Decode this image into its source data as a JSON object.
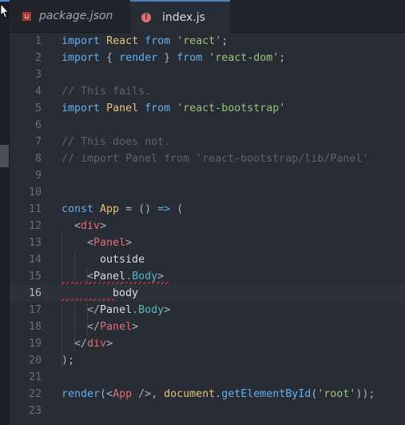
{
  "tabs": [
    {
      "label": "package.json",
      "icon": "npm-package-icon",
      "active": false
    },
    {
      "label": "index.js",
      "icon": "error-icon",
      "active": true
    }
  ],
  "editor": {
    "current_line": 16,
    "lines": [
      {
        "n": "1",
        "tokens": [
          [
            "kw",
            "import"
          ],
          [
            "op",
            " "
          ],
          [
            "cls",
            "React"
          ],
          [
            "op",
            " "
          ],
          [
            "kw",
            "from"
          ],
          [
            "op",
            " "
          ],
          [
            "str",
            "'react'"
          ],
          [
            "op",
            ";"
          ]
        ]
      },
      {
        "n": "2",
        "tokens": [
          [
            "kw",
            "import"
          ],
          [
            "op",
            " { "
          ],
          [
            "fn",
            "render"
          ],
          [
            "op",
            " } "
          ],
          [
            "kw",
            "from"
          ],
          [
            "op",
            " "
          ],
          [
            "str",
            "'react-dom'"
          ],
          [
            "op",
            ";"
          ]
        ]
      },
      {
        "n": "3",
        "tokens": []
      },
      {
        "n": "4",
        "tokens": [
          [
            "cm",
            "// This fails."
          ]
        ]
      },
      {
        "n": "5",
        "tokens": [
          [
            "kw",
            "import"
          ],
          [
            "op",
            " "
          ],
          [
            "cls",
            "Panel"
          ],
          [
            "op",
            " "
          ],
          [
            "kw",
            "from"
          ],
          [
            "op",
            " "
          ],
          [
            "str",
            "'react-bootstrap'"
          ]
        ]
      },
      {
        "n": "6",
        "tokens": []
      },
      {
        "n": "7",
        "tokens": [
          [
            "cm",
            "// This does not."
          ]
        ]
      },
      {
        "n": "8",
        "tokens": [
          [
            "cm",
            "// import Panel from 'react-bootstrap/lib/Panel'"
          ]
        ]
      },
      {
        "n": "9",
        "tokens": []
      },
      {
        "n": "10",
        "tokens": []
      },
      {
        "n": "11",
        "tokens": [
          [
            "kw",
            "const"
          ],
          [
            "op",
            " "
          ],
          [
            "cls",
            "App"
          ],
          [
            "op",
            " = () "
          ],
          [
            "kw",
            "=>"
          ],
          [
            "op",
            " ("
          ]
        ]
      },
      {
        "n": "12",
        "tokens": [
          [
            "op",
            "  <"
          ],
          [
            "tag",
            "div"
          ],
          [
            "op",
            ">"
          ]
        ]
      },
      {
        "n": "13",
        "tokens": [
          [
            "op",
            "    <"
          ],
          [
            "tag",
            "Panel"
          ],
          [
            "op",
            ">"
          ]
        ]
      },
      {
        "n": "14",
        "tokens": [
          [
            "plain",
            "      outside"
          ]
        ]
      },
      {
        "n": "15",
        "tokens": [
          [
            "op",
            "    <"
          ],
          [
            "plain",
            "Panel"
          ],
          [
            "attr",
            ".Body"
          ],
          [
            "op",
            ">"
          ]
        ]
      },
      {
        "n": "16",
        "tokens": [
          [
            "plain",
            "        body"
          ]
        ]
      },
      {
        "n": "17",
        "tokens": [
          [
            "op",
            "    </"
          ],
          [
            "plain",
            "Panel"
          ],
          [
            "attr",
            ".Body"
          ],
          [
            "op",
            ">"
          ]
        ]
      },
      {
        "n": "18",
        "tokens": [
          [
            "op",
            "    </"
          ],
          [
            "tag",
            "Panel"
          ],
          [
            "op",
            ">"
          ]
        ]
      },
      {
        "n": "19",
        "tokens": [
          [
            "op",
            "  </"
          ],
          [
            "tag",
            "div"
          ],
          [
            "op",
            ">"
          ]
        ]
      },
      {
        "n": "20",
        "tokens": [
          [
            "op",
            ");"
          ]
        ]
      },
      {
        "n": "21",
        "tokens": []
      },
      {
        "n": "22",
        "tokens": [
          [
            "fn",
            "render"
          ],
          [
            "op",
            "(<"
          ],
          [
            "tag",
            "App"
          ],
          [
            "op",
            " />, "
          ],
          [
            "cls",
            "document"
          ],
          [
            "op",
            "."
          ],
          [
            "fn",
            "getElementById"
          ],
          [
            "op",
            "("
          ],
          [
            "str",
            "'root'"
          ],
          [
            "op",
            "));"
          ]
        ]
      },
      {
        "n": "23",
        "tokens": []
      }
    ]
  },
  "colors": {
    "background": "#282c34",
    "keyword": "#61afef",
    "class": "#e5c07b",
    "string": "#98c379",
    "comment": "#5c6370",
    "tag": "#e06c75",
    "property": "#56b6c2",
    "error_squiggle": "#e03c3c"
  }
}
